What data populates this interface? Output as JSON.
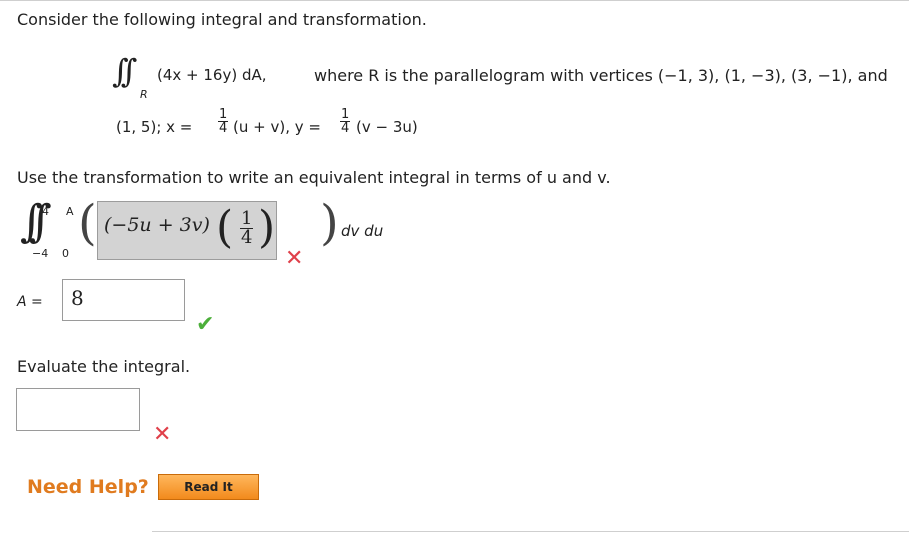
{
  "question": {
    "intro": "Consider the following integral and transformation.",
    "integral_sign": "∫∫",
    "region_sub": "R",
    "integrand": "(4x + 16y) dA,",
    "where_text": "where R is the parallelogram with vertices (−1, 3), (1, −3), (3, −1), and",
    "line2_start": "(1, 5);  x =",
    "frac1_num": "1",
    "frac1_den": "4",
    "x_expr": "(u + v),  y =",
    "frac2_num": "1",
    "frac2_den": "4",
    "y_expr": "(v − 3u)",
    "instruction": "Use the transformation to write an equivalent integral in terms of u and v."
  },
  "transformed_integral": {
    "outer_upper": "4",
    "outer_lower": "−4",
    "inner_upper": "A",
    "inner_lower": "0",
    "answer_expr": "(−5u + 3v)",
    "answer_frac_num": "1",
    "answer_frac_den": "4",
    "differentials": "dv du",
    "status": "incorrect"
  },
  "a_field": {
    "label": "A  =",
    "value": "8",
    "status": "correct"
  },
  "evaluate": {
    "prompt": "Evaluate the integral.",
    "value": "",
    "status": "incorrect"
  },
  "help": {
    "need_help": "Need Help?",
    "read_it": "Read It"
  },
  "icons": {
    "incorrect": "x-mark-icon",
    "correct": "check-mark-icon"
  },
  "colors": {
    "incorrect": "#e0404a",
    "correct": "#4caf3a",
    "need_help": "#e07b1f",
    "button": "#f28a1c"
  }
}
